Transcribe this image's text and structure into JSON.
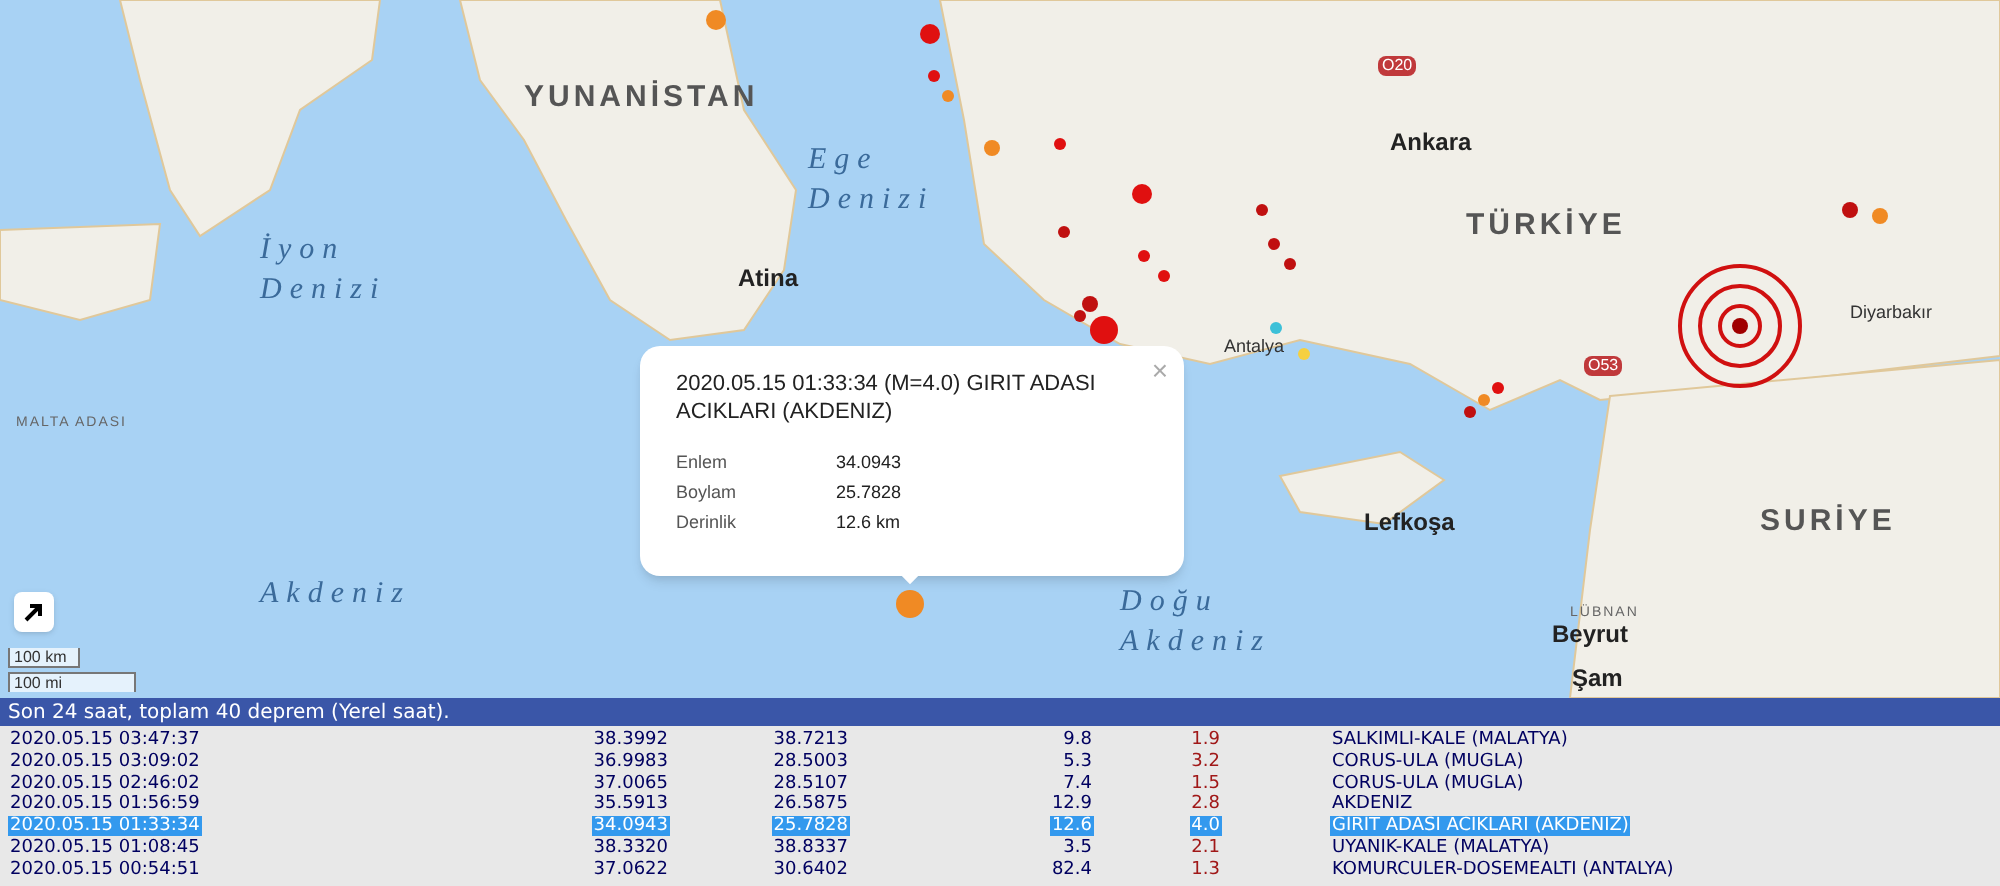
{
  "map": {
    "labels": [
      {
        "text": "YUNANİSTAN",
        "kind": "country"
      },
      {
        "text": "TÜRKİYE",
        "kind": "country"
      },
      {
        "text": "SURİYE",
        "kind": "country"
      },
      {
        "text": "LÜBNAN",
        "kind": "minor"
      },
      {
        "text": "MALTA ADASI",
        "kind": "minor"
      },
      {
        "text": "Ege Denizi",
        "kind": "sea"
      },
      {
        "text": "İyon Denizi",
        "kind": "sea"
      },
      {
        "text": "Akdeniz",
        "kind": "sea"
      },
      {
        "text": "Doğu Akdeniz",
        "kind": "sea"
      },
      {
        "text": "Atina",
        "kind": "capital"
      },
      {
        "text": "Ankara",
        "kind": "capital"
      },
      {
        "text": "Lefkoşa",
        "kind": "capital"
      },
      {
        "text": "Beyrut",
        "kind": "capital"
      },
      {
        "text": "Şam",
        "kind": "capital"
      },
      {
        "text": "Diyarbakır",
        "kind": "city"
      },
      {
        "text": "Antalya",
        "kind": "city"
      }
    ],
    "road_signs": [
      "O20",
      "O53"
    ],
    "markers": [
      {
        "color": "#f08a24"
      },
      {
        "color": "#e01010"
      },
      {
        "color": "#f08a24"
      },
      {
        "color": "#e01010"
      },
      {
        "color": "#f08a24"
      },
      {
        "color": "#e01010"
      },
      {
        "color": "#e01010"
      },
      {
        "color": "#c01010"
      },
      {
        "color": "#e01010"
      },
      {
        "color": "#c01010"
      },
      {
        "color": "#e01010"
      },
      {
        "color": "#c01010"
      },
      {
        "color": "#e01010"
      },
      {
        "color": "#c01010"
      },
      {
        "color": "#c01010"
      },
      {
        "color": "#c01010"
      },
      {
        "color": "#3cc0d8"
      },
      {
        "color": "#f5d040"
      },
      {
        "color": "#c01010"
      },
      {
        "color": "#f08a24"
      },
      {
        "color": "#c01010"
      },
      {
        "color": "#f08a24"
      },
      {
        "color": "#e01010"
      },
      {
        "color": "#f08a24"
      }
    ],
    "scale": [
      "100 km",
      "100 mi"
    ],
    "popup": {
      "title": "2020.05.15 01:33:34 (M=4.0) GIRIT ADASI ACIKLARI (AKDENIZ)",
      "close": "×",
      "fields": [
        {
          "label": "Enlem",
          "value": "34.0943"
        },
        {
          "label": "Boylam",
          "value": "25.7828"
        },
        {
          "label": "Derinlik",
          "value": "12.6 km"
        }
      ]
    }
  },
  "list": {
    "header": "Son 24 saat, toplam 40 deprem (Yerel saat).",
    "rows": [
      {
        "date": "2020.05.15 03:47:37",
        "lat": "38.3992",
        "lon": "38.7213",
        "depth": "9.8",
        "mag": "1.9",
        "place": "SALKIMLI-KALE (MALATYA)",
        "selected": false
      },
      {
        "date": "2020.05.15 03:09:02",
        "lat": "36.9983",
        "lon": "28.5003",
        "depth": "5.3",
        "mag": "3.2",
        "place": "CORUS-ULA (MUGLA)",
        "selected": false
      },
      {
        "date": "2020.05.15 02:46:02",
        "lat": "37.0065",
        "lon": "28.5107",
        "depth": "7.4",
        "mag": "1.5",
        "place": "CORUS-ULA (MUGLA)",
        "selected": false
      },
      {
        "date": "2020.05.15 01:56:59",
        "lat": "35.5913",
        "lon": "26.5875",
        "depth": "12.9",
        "mag": "2.8",
        "place": "AKDENIZ",
        "selected": false
      },
      {
        "date": "2020.05.15 01:33:34",
        "lat": "34.0943",
        "lon": "25.7828",
        "depth": "12.6",
        "mag": "4.0",
        "place": "GIRIT ADASI ACIKLARI (AKDENIZ)",
        "selected": true
      },
      {
        "date": "2020.05.15 01:08:45",
        "lat": "38.3320",
        "lon": "38.8337",
        "depth": "3.5",
        "mag": "2.1",
        "place": "UYANIK-KALE (MALATYA)",
        "selected": false
      },
      {
        "date": "2020.05.15 00:54:51",
        "lat": "37.0622",
        "lon": "30.6402",
        "depth": "82.4",
        "mag": "1.3",
        "place": "KOMURCULER-DOSEMEALTI (ANTALYA)",
        "selected": false
      }
    ]
  }
}
